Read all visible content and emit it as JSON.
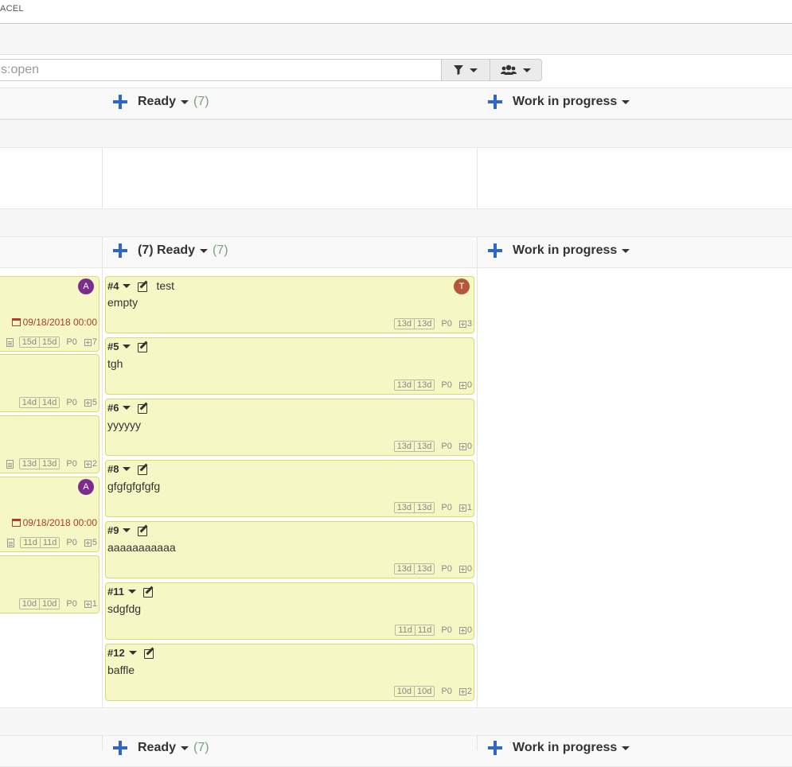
{
  "topbar": {
    "title": "ACEL"
  },
  "search": {
    "value": "s:open"
  },
  "toolbar": {
    "filter_icon": "filter-icon",
    "people_icon": "users-icon"
  },
  "board": {
    "lane1": {
      "ready": {
        "label": "Ready",
        "count": "(7)"
      },
      "wip": {
        "label": "Work in progress"
      }
    },
    "lane2": {
      "ready": {
        "label": "(7) Ready",
        "count": "(7)"
      },
      "wip": {
        "label": "Work in progress"
      }
    },
    "lane3": {
      "ready": {
        "label": "Ready",
        "count": "(7)"
      },
      "wip": {
        "label": "Work in progress"
      }
    }
  },
  "left_cards": [
    {
      "avatar": "A",
      "avatar_color": "#7b2d8e",
      "due": "09/18/2018 00:00",
      "d1": "15d",
      "d2": "15d",
      "prio": "P0",
      "subs": "7",
      "has_doc": true
    },
    {
      "d1": "14d",
      "d2": "14d",
      "prio": "P0",
      "subs": "5"
    },
    {
      "d1": "13d",
      "d2": "13d",
      "prio": "P0",
      "subs": "2",
      "has_doc": true
    },
    {
      "avatar": "A",
      "avatar_color": "#7b2d8e",
      "due": "09/18/2018 00:00",
      "d1": "11d",
      "d2": "11d",
      "prio": "P0",
      "subs": "5",
      "has_doc": true
    },
    {
      "d1": "10d",
      "d2": "10d",
      "prio": "P0",
      "subs": "1"
    }
  ],
  "cards": [
    {
      "id": "#4",
      "title": "test",
      "desc": "empty",
      "avatar": "T",
      "avatar_color": "#b5553a",
      "d1": "13d",
      "d2": "13d",
      "prio": "P0",
      "subs": "3"
    },
    {
      "id": "#5",
      "title": "",
      "desc": "tgh",
      "d1": "13d",
      "d2": "13d",
      "prio": "P0",
      "subs": "0"
    },
    {
      "id": "#6",
      "title": "",
      "desc": "yyyyyy",
      "d1": "13d",
      "d2": "13d",
      "prio": "P0",
      "subs": "0"
    },
    {
      "id": "#8",
      "title": "",
      "desc": "gfgfgfgfgfg",
      "d1": "13d",
      "d2": "13d",
      "prio": "P0",
      "subs": "1"
    },
    {
      "id": "#9",
      "title": "",
      "desc": "aaaaaaaaaaa",
      "d1": "13d",
      "d2": "13d",
      "prio": "P0",
      "subs": "0"
    },
    {
      "id": "#11",
      "title": "",
      "desc": "sdgfdg",
      "d1": "11d",
      "d2": "11d",
      "prio": "P0",
      "subs": "0"
    },
    {
      "id": "#12",
      "title": "",
      "desc": "baffle",
      "d1": "10d",
      "d2": "10d",
      "prio": "P0",
      "subs": "2"
    }
  ]
}
